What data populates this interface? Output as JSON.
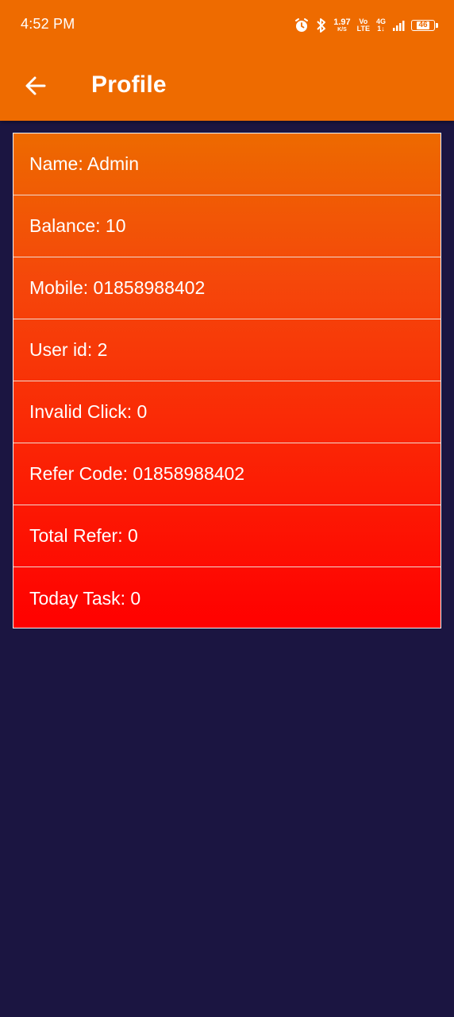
{
  "status_bar": {
    "time": "4:52 PM",
    "speed_value": "1.97",
    "speed_unit": "K/S",
    "volte_top": "Vo",
    "volte_bottom": "LTE",
    "network_top": "4G",
    "network_bottom": "1↓",
    "battery_level": "46",
    "icons": [
      "alarm-icon",
      "bluetooth-icon",
      "signal-icon",
      "battery-icon"
    ]
  },
  "app_bar": {
    "title": "Profile",
    "back_icon": "arrow-left-icon",
    "color": "#ee6b00"
  },
  "profile": {
    "rows": [
      {
        "text": "Name: Admin"
      },
      {
        "text": "Balance: 10"
      },
      {
        "text": "Mobile: 01858988402"
      },
      {
        "text": "User id: 2"
      },
      {
        "text": "Invalid Click: 0"
      },
      {
        "text": "Refer Code: 01858988402"
      },
      {
        "text": "Total Refer: 0"
      },
      {
        "text": "Today Task: 0"
      }
    ]
  },
  "colors": {
    "background": "#1b1541",
    "gradient_top": "#ed6a00",
    "gradient_bottom": "#ff0000"
  }
}
